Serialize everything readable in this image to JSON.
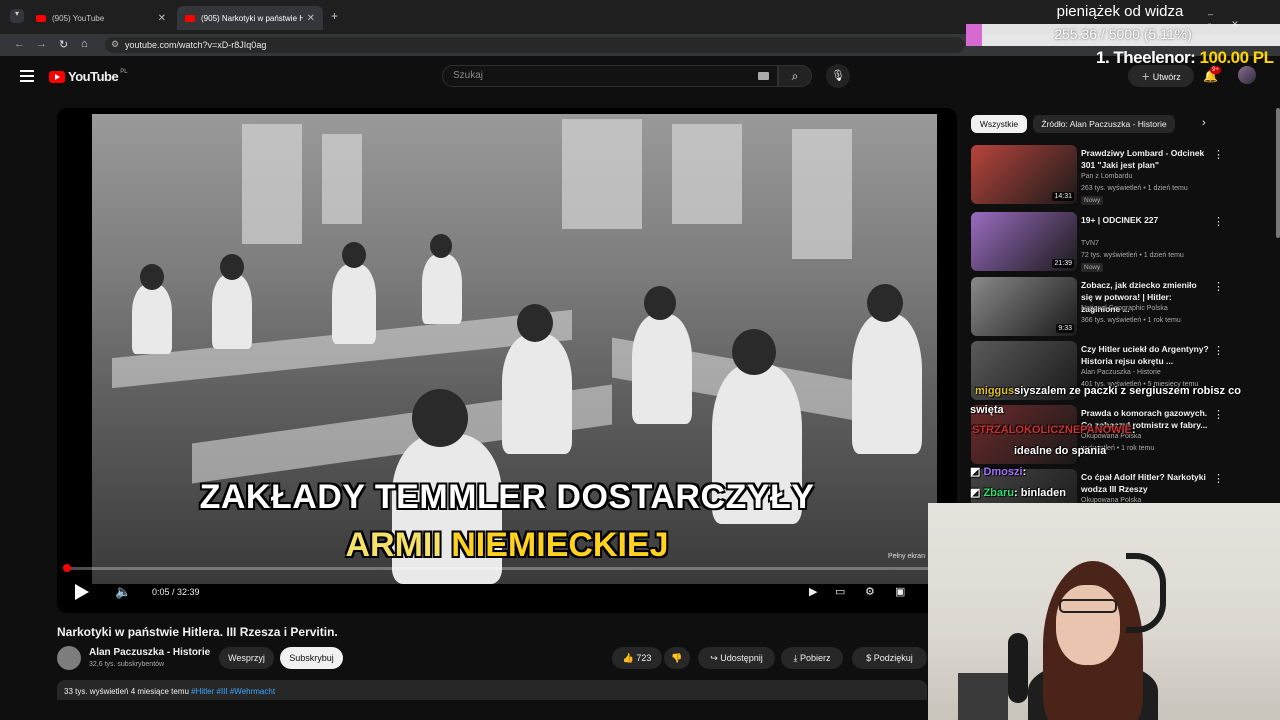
{
  "browser": {
    "tabs": [
      {
        "label": "(905) YouTube",
        "active": false
      },
      {
        "label": "(905) Narkotyki w państwie Hitl",
        "active": true
      }
    ],
    "new_tab": "+",
    "url": "youtube.com/watch?v=xD-r8JIq0ag"
  },
  "yt": {
    "logo": "YouTube",
    "country": "PL",
    "search_placeholder": "Szukaj",
    "create_label": "Utwórz",
    "notifications": "9+"
  },
  "player": {
    "caption_line1": "ZAKŁADY TEMMLER DOSTARCZYŁY",
    "caption_line2_white": "ARMII",
    "caption_line2_yellow": "NIEMIECKIEJ",
    "time": "0:05 / 32:39",
    "progress_fraction": 0.0026,
    "fullscreen_hint": "Pełny ekran"
  },
  "video": {
    "title": "Narkotyki w państwie Hitlera. III Rzesza i Pervitin.",
    "channel": "Alan Paczuszka - Historie",
    "subscribers": "32,6 tys. subskrybentów",
    "support_label": "Wesprzyj",
    "subscribe_label": "Subskrybuj",
    "likes": "723",
    "share_label": "Udostępnij",
    "download_label": "Pobierz",
    "thanks_label": "Podziękuj",
    "meta_views": "33 tys. wyświetleń  4 miesiące temu",
    "meta_tags": "#Hitler #III #Wehrmacht"
  },
  "chips": [
    "Wszystkie",
    "Źródło: Alan Paczuszka - Historie"
  ],
  "recommendations": [
    {
      "title": "Prawdziwy Lombard - Odcinek 301 \"Jaki jest plan\"",
      "channel": "Pan z Lombardu",
      "meta": "263 tys. wyświetleń • 1 dzień temu",
      "badge": "Nowy",
      "duration": "14:31",
      "color": "#b7443c"
    },
    {
      "title": "19+ | ODCINEK 227",
      "channel": "TVN7",
      "meta": "72 tys. wyświetleń • 1 dzień temu",
      "badge": "Nowy",
      "duration": "21:39",
      "color": "#9a6cc0"
    },
    {
      "title": "Zobacz, jak dziecko zmieniło się w potwora! | Hitler: zaginione ...",
      "channel": "National Geographic Polska",
      "meta": "366 tys. wyświetleń • 1 rok temu",
      "badge": "",
      "duration": "9:33",
      "color": "#8a8a8a"
    },
    {
      "title": "Czy Hitler uciekł do Argentyny? Historia rejsu okrętu ...",
      "channel": "Alan Paczuszka - Historie",
      "meta": "401 tys. wyświetleń • 5 miesięcy temu",
      "badge": "",
      "duration": "",
      "color": "#5a5a5a"
    },
    {
      "title": "Prawda o komorach gazowych. Co zobaczył rotmistrz w fabry...",
      "channel": "Okupowana Polska",
      "meta": "wyświetleń • 1 rok temu",
      "badge": "",
      "duration": "",
      "color": "#6c2a2a"
    },
    {
      "title": "Co ćpał Adolf Hitler? Narkotyki wodza III Rzeszy",
      "channel": "Okupowana Polska",
      "meta": "",
      "badge": "",
      "duration": "",
      "color": "#444444"
    }
  ],
  "overlay": {
    "donation_title": "pieniążek od widza",
    "donation_progress": "255.36 / 5000 (5.11%)",
    "donation_fraction": 0.0511,
    "top_donor": "1. Theelenor:",
    "top_donor_value": "100.00 PL",
    "chat": [
      {
        "user": "miggus",
        "text": "siyszalem ze paczki z sergiuszem robisz co",
        "user_color": "u1"
      },
      {
        "user": "",
        "text": "swięta",
        "user_color": "u1"
      },
      {
        "user": "STRZALOKOLICZNEPANOWIE",
        "text": ":",
        "user_color": "u2"
      },
      {
        "user": "",
        "text": "idealne do spania",
        "user_color": "u2"
      },
      {
        "user": "Dmoszi",
        "text": ":",
        "user_color": "u3"
      },
      {
        "user": "Zbaru",
        "text": ": binladen",
        "user_color": "u4"
      }
    ]
  }
}
